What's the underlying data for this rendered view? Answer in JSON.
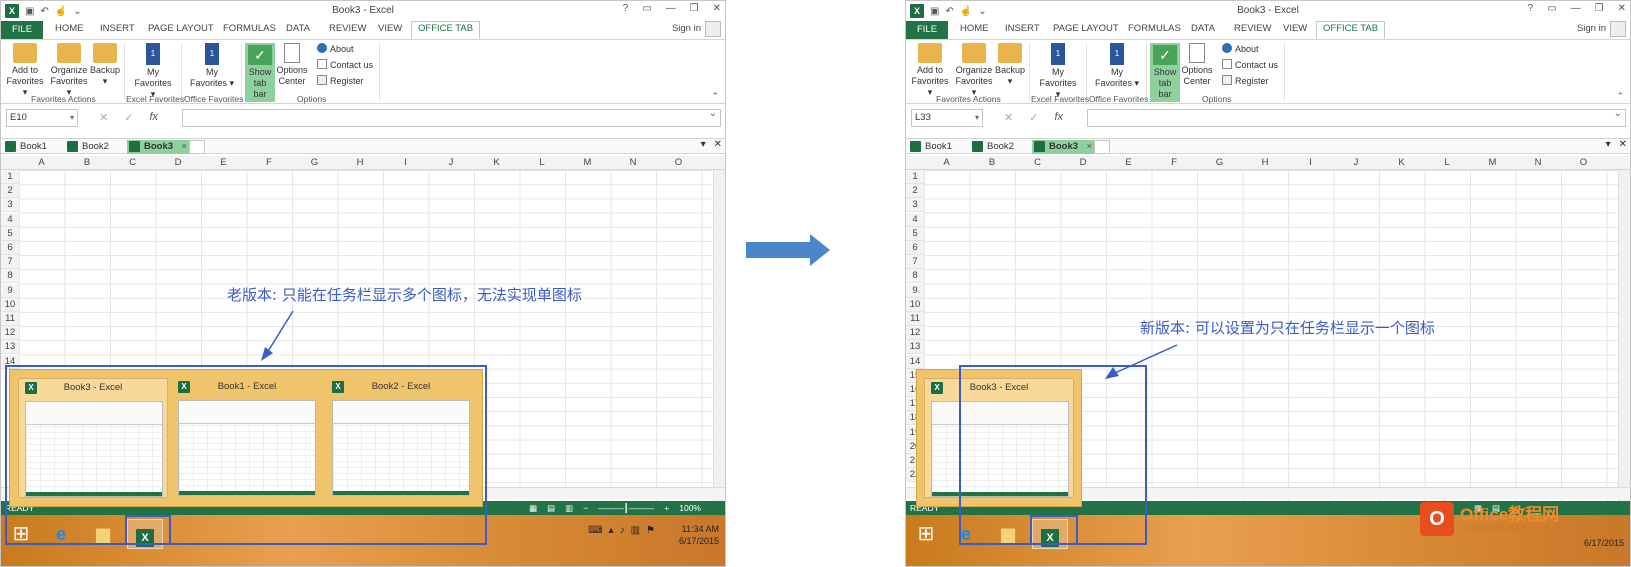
{
  "left": {
    "window_title": "Book3 - Excel",
    "ribbon_tabs": [
      "FILE",
      "HOME",
      "INSERT",
      "PAGE LAYOUT",
      "FORMULAS",
      "DATA",
      "REVIEW",
      "VIEW",
      "OFFICE TAB"
    ],
    "sign_in": "Sign in",
    "buttons": {
      "add_to_favorites": "Add to Favorites",
      "organize_favorites": "Organize Favorites",
      "backup": "Backup",
      "my_favorites": "My Favorites",
      "my_favorites_2": "My Favorites",
      "show_tab_bar": "Show tab bar",
      "options_center": "Options Center",
      "about": "About",
      "contact_us": "Contact us",
      "register": "Register"
    },
    "groups": [
      "Favorites Actions",
      "Excel Favorites",
      "Office Favorites",
      "Options"
    ],
    "name_box": "E10",
    "workbook_tabs": [
      "Book1",
      "Book2",
      "Book3"
    ],
    "active_tab": "Book3",
    "columns": [
      "A",
      "B",
      "C",
      "D",
      "E",
      "F",
      "G",
      "H",
      "I",
      "J",
      "K",
      "L",
      "M",
      "N",
      "O"
    ],
    "rows": [
      "1",
      "2",
      "3",
      "4",
      "5",
      "6",
      "7",
      "8",
      "9",
      "10",
      "11",
      "12",
      "13",
      "14"
    ],
    "status": "READY",
    "zoom": "100%",
    "previews": [
      "Book3 - Excel",
      "Book1 - Excel",
      "Book2 - Excel"
    ],
    "clock_time": "11:34 AM",
    "clock_date": "6/17/2015",
    "note": "老版本: 只能在任务栏显示多个图标，无法实现单图标"
  },
  "right": {
    "window_title": "Book3 - Excel",
    "name_box": "L33",
    "rows": [
      "1",
      "2",
      "3",
      "4",
      "5",
      "6",
      "7",
      "8",
      "9",
      "10",
      "11",
      "12",
      "13",
      "14",
      "15",
      "16",
      "17",
      "18",
      "19",
      "20",
      "21",
      "22"
    ],
    "previews": [
      "Book3 - Excel"
    ],
    "status": "READY",
    "clock_date": "6/17/2015",
    "note": "新版本: 可以设置为只在任务栏显示一个图标"
  },
  "brand": {
    "title": "Office教程网",
    "url": "www.office26.com"
  },
  "colors": {
    "excel_green": "#217346",
    "annotation_blue": "#3a5cc9",
    "arrow_blue": "#4a86c8"
  }
}
